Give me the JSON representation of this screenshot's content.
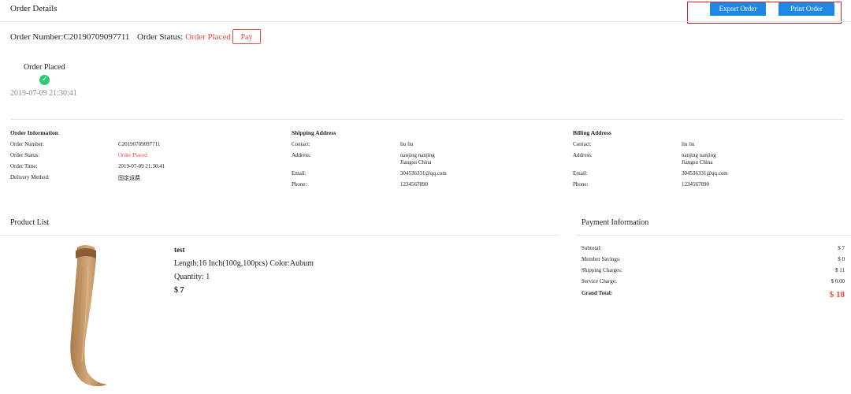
{
  "header": {
    "title": "Order Details",
    "export_label": "Export Order",
    "print_label": "Print Order"
  },
  "order": {
    "number_text": "Order Number:C20190709097711",
    "status_label": "Order Status:",
    "status_value": "Order Placed",
    "pay_label": "Pay"
  },
  "timeline": {
    "step_label": "Order Placed",
    "step_time": "2019-07-09 21:30:41"
  },
  "order_info": {
    "heading": "Order Information",
    "rows": [
      {
        "label": "Order Number:",
        "value": "C20190709097711"
      },
      {
        "label": "Order Status:",
        "value": "Order Placed"
      },
      {
        "label": "Order Time:",
        "value": "2019-07-09 21:30:41"
      },
      {
        "label": "Delivery Method:",
        "value": "固定运费"
      }
    ]
  },
  "shipping": {
    "heading": "Shipping Address",
    "contact_label": "Contact:",
    "contact_value": "liu liu",
    "address_label": "Address:",
    "address_line1": "nanjing nanjing",
    "address_line2": "Jiangsu China",
    "email_label": "Email:",
    "email_value": "304536331@qq.com",
    "phone_label": "Phone:",
    "phone_value": "1234567890"
  },
  "billing": {
    "heading": "Billing Address",
    "contact_label": "Contact:",
    "contact_value": "liu liu",
    "address_label": "Address:",
    "address_line1": "nanjing nanjing",
    "address_line2": "Jiangsu China",
    "email_label": "Email:",
    "email_value": "304536331@qq.com",
    "phone_label": "Phone:",
    "phone_value": "1234567890"
  },
  "product_list": {
    "title": "Product List",
    "item": {
      "name": "test",
      "spec": "Length:16 Inch(100g,100pcs)  Color:Aubum",
      "quantity": "Quantity: 1",
      "price": "$ 7"
    }
  },
  "payment": {
    "title": "Payment Information",
    "rows": [
      {
        "label": "Subtotal:",
        "value": "$ 7"
      },
      {
        "label": "Member Savings:",
        "value": "$ 0"
      },
      {
        "label": "Shipping Charges:",
        "value": "$ 11"
      },
      {
        "label": "Service Charge:",
        "value": "$ 0.00"
      }
    ],
    "grand_label": "Grand Total:",
    "grand_value": "$ 18"
  },
  "colors": {
    "accent": "#1e88e5",
    "status_red": "#e74c3c",
    "success": "#2ecc71"
  },
  "icons": [
    "check-icon"
  ]
}
